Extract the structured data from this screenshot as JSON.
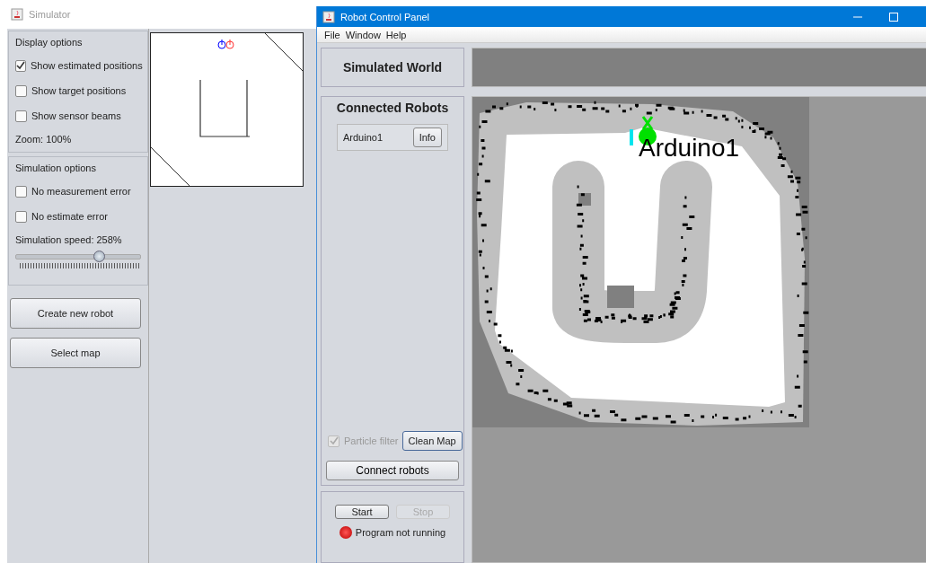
{
  "simulator": {
    "title": "Simulator",
    "display_options": {
      "title": "Display options",
      "checkboxes": [
        {
          "label": "Show estimated positions",
          "checked": true
        },
        {
          "label": "Show target positions",
          "checked": false
        },
        {
          "label": "Show sensor beams",
          "checked": false
        }
      ],
      "zoom": "Zoom:  100%"
    },
    "simulation_options": {
      "title": "Simulation options",
      "checkboxes": [
        {
          "label": "No measurement error",
          "checked": false
        },
        {
          "label": "No estimate error",
          "checked": false
        }
      ],
      "speed": "Simulation speed:  258%",
      "speed_slider": {
        "level": 0.67
      }
    },
    "buttons": [
      "Create new robot",
      "Select map"
    ]
  },
  "control_panel": {
    "title": "Robot Control Panel",
    "menu": [
      "File",
      "Window",
      "Help"
    ],
    "simulated_world": "Simulated World",
    "connected_robots": {
      "title": "Connected Robots",
      "robots": [
        {
          "name": "Arduino1",
          "button": "Info"
        }
      ],
      "particle_filter": {
        "label": "Particle filter",
        "checked": true,
        "disabled": true
      },
      "clean_map": "Clean Map",
      "connect": "Connect robots"
    },
    "program": {
      "start": {
        "label": "Start",
        "disabled": false
      },
      "stop": {
        "label": "Stop",
        "disabled": true
      },
      "status": "Program not running",
      "running": false
    },
    "map": {
      "robot_label": "Arduino1"
    }
  }
}
